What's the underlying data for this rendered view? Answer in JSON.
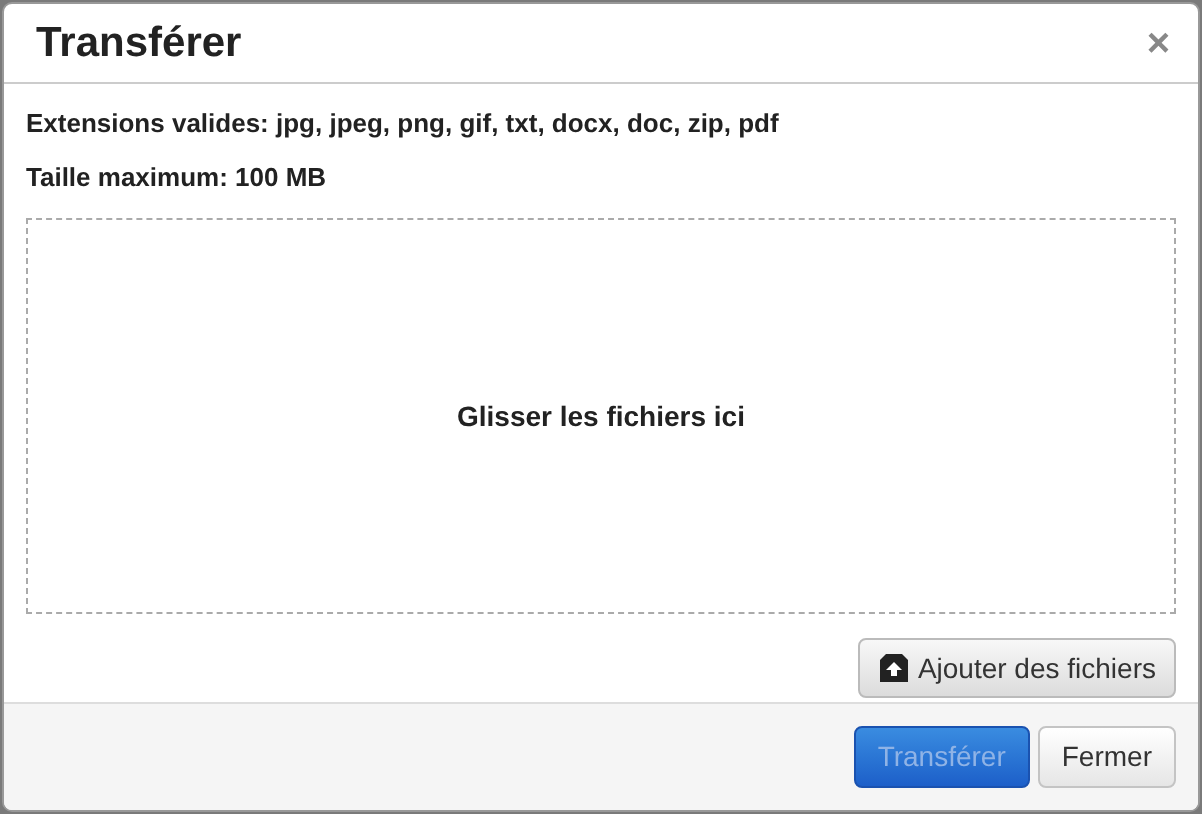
{
  "dialog": {
    "title": "Transférer",
    "close": "×"
  },
  "info": [
    "Extensions valides: jpg, jpeg, png, gif, txt, docx, doc, zip, pdf",
    "Taille maximum: 100 MB"
  ],
  "dropzone": {
    "label": "Glisser les fichiers ici"
  },
  "add_button": {
    "label": "Ajouter des fichiers"
  },
  "footer_buttons": [
    {
      "label": "Transférer",
      "kind": "primary",
      "disabled": true
    },
    {
      "label": "Fermer",
      "kind": "default",
      "disabled": false
    }
  ]
}
